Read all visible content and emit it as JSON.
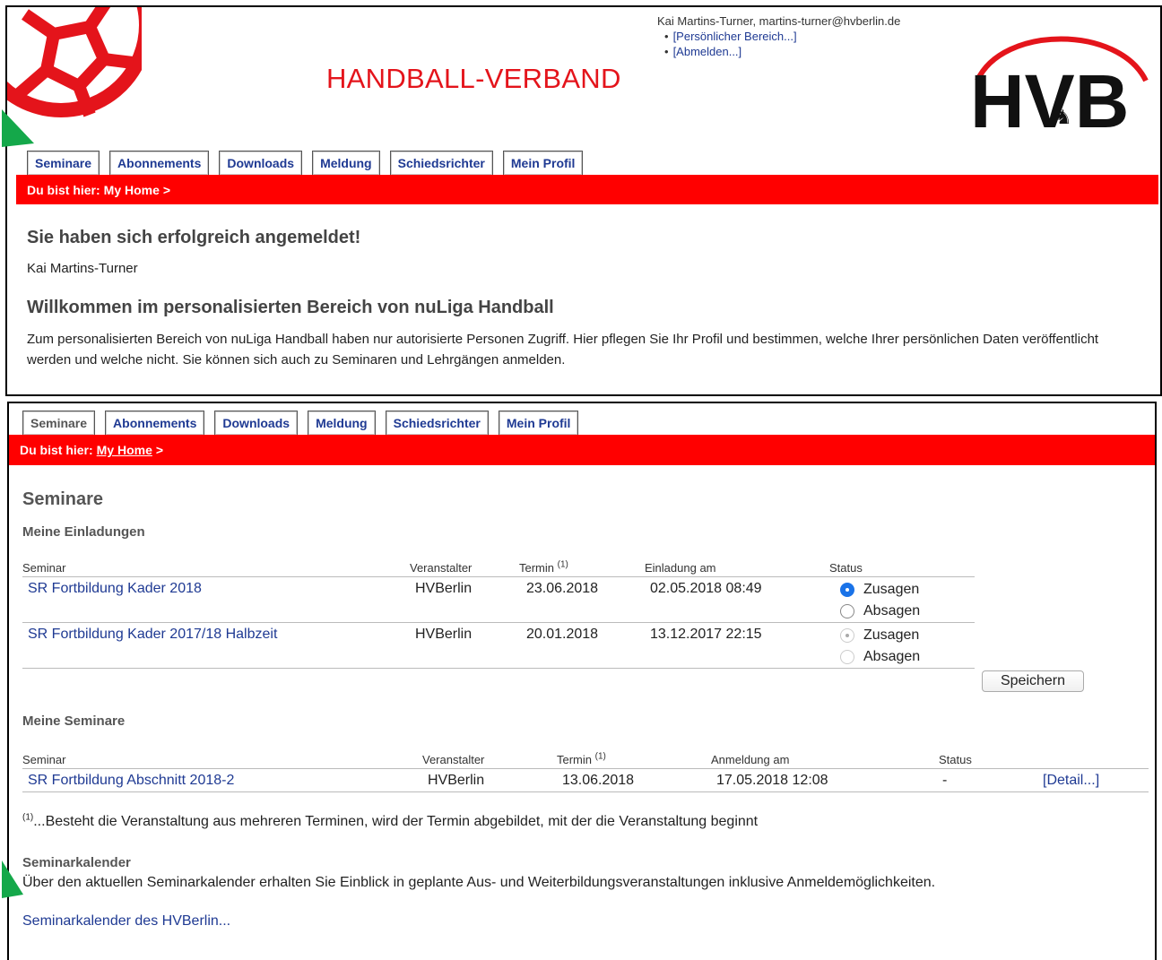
{
  "header": {
    "org_title": "HANDBALL-VERBAND",
    "user_line": "Kai Martins-Turner, martins-turner@hvberlin.de",
    "links": [
      "[Persönlicher Bereich...]",
      "[Abmelden...]"
    ],
    "logo_text": "HVB"
  },
  "nav": {
    "tabs": [
      "Seminare",
      "Abonnements",
      "Downloads",
      "Meldung",
      "Schiedsrichter",
      "Mein Profil"
    ]
  },
  "panel1": {
    "breadcrumb_prefix": "Du bist hier:",
    "breadcrumb_link": "My Home",
    "breadcrumb_sep": ">",
    "login_heading": "Sie haben sich erfolgreich angemeldet!",
    "user_name": "Kai Martins-Turner",
    "welcome_heading": "Willkommen im personalisierten Bereich von nuLiga Handball",
    "welcome_text": "Zum personalisierten Bereich von nuLiga Handball haben nur autorisierte Personen Zugriff. Hier pflegen Sie Ihr Profil und bestimmen, welche Ihrer persönlichen Daten veröffentlicht werden und welche nicht. Sie können sich auch zu Seminaren und Lehrgängen anmelden."
  },
  "panel2": {
    "breadcrumb_prefix": "Du bist hier:",
    "breadcrumb_link": "My Home",
    "breadcrumb_sep": ">",
    "page_title": "Seminare",
    "invitations": {
      "heading": "Meine Einladungen",
      "columns": [
        "Seminar",
        "Veranstalter",
        "Termin",
        "Einladung am",
        "Status"
      ],
      "footnote_mark": "(1)",
      "rows": [
        {
          "seminar": "SR Fortbildung Kader 2018",
          "organizer": "HVBerlin",
          "date": "23.06.2018",
          "invited": "02.05.2018 08:49",
          "option_yes": "Zusagen",
          "option_no": "Absagen"
        },
        {
          "seminar": "SR Fortbildung Kader 2017/18 Halbzeit",
          "organizer": "HVBerlin",
          "date": "20.01.2018",
          "invited": "13.12.2017 22:15",
          "option_yes": "Zusagen",
          "option_no": "Absagen"
        }
      ],
      "save_label": "Speichern"
    },
    "my_seminars": {
      "heading": "Meine Seminare",
      "columns": [
        "Seminar",
        "Veranstalter",
        "Termin",
        "Anmeldung am",
        "Status"
      ],
      "footnote_mark": "(1)",
      "rows": [
        {
          "seminar": "SR Fortbildung Abschnitt 2018-2",
          "organizer": "HVBerlin",
          "date": "13.06.2018",
          "registered": "17.05.2018 12:08",
          "status": "-",
          "detail": "[Detail...]"
        }
      ]
    },
    "footnote_mark": "(1)",
    "footnote_text": "...Besteht die Veranstaltung aus mehreren Terminen, wird der Termin abgebildet, mit der die Veranstaltung beginnt",
    "calendar_heading": "Seminarkalender",
    "calendar_text": "Über den aktuellen Seminarkalender erhalten Sie Einblick in geplante Aus- und Weiterbildungsveranstaltungen inklusive Anmeldemöglichkeiten.",
    "calendar_link": "Seminarkalender des HVBerlin..."
  },
  "colors": {
    "brand_red": "#ff0000",
    "link_blue": "#1f3a93",
    "arrow_green": "#14a84a"
  }
}
